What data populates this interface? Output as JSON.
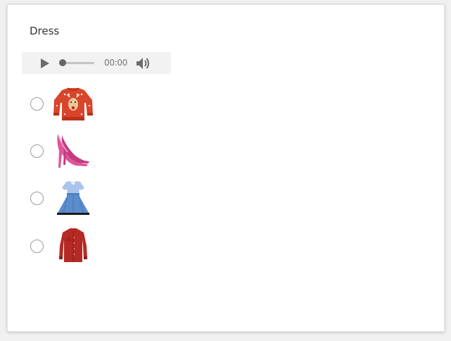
{
  "question": {
    "title": "Dress"
  },
  "audio": {
    "time": "00:00",
    "progress": 0,
    "play_icon": "play-icon",
    "volume_icon": "volume-icon"
  },
  "options": [
    {
      "item": "sweater",
      "icon": "reindeer-sweater-image",
      "selected": false
    },
    {
      "item": "high-heels",
      "icon": "pink-high-heels-image",
      "selected": false
    },
    {
      "item": "dress",
      "icon": "blue-dress-image",
      "selected": false
    },
    {
      "item": "shirt",
      "icon": "red-shirt-image",
      "selected": false
    }
  ],
  "colors": {
    "sweater_red": "#d9452b",
    "heels_pink": "#e0559a",
    "dress_blue": "#5b8ccc",
    "shirt_red": "#b52a24"
  }
}
